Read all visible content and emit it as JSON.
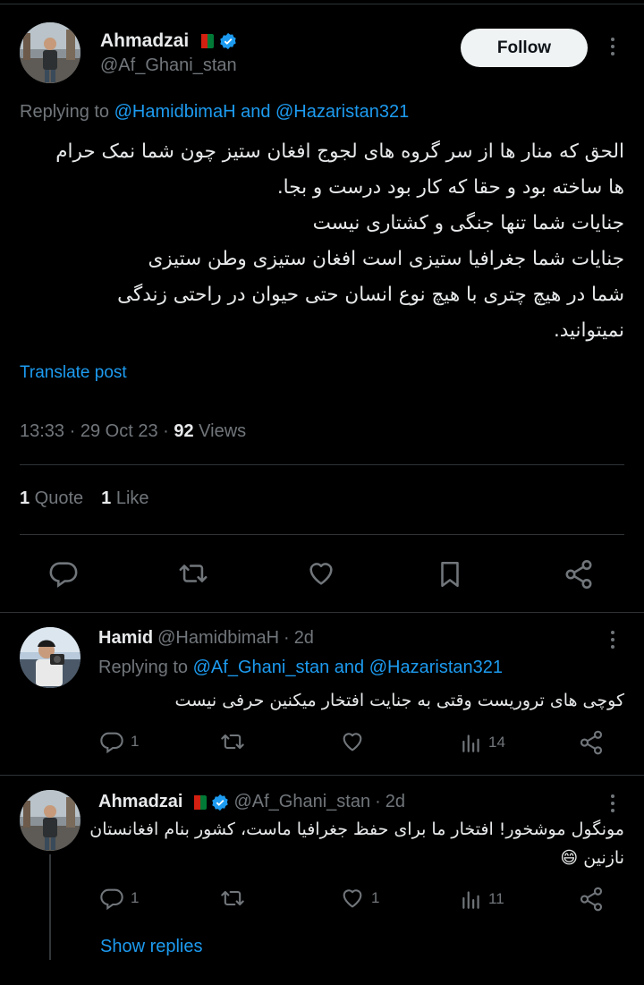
{
  "main": {
    "author_name": "Ahmadzai",
    "author_handle": "@Af_Ghani_stan",
    "follow_label": "Follow",
    "replying_prefix": "Replying to ",
    "replying_user1": "@HamidbimaH",
    "replying_and": " and ",
    "replying_user2": "@Hazaristan321",
    "text_lines": [
      "الحق که منار ها از سر گروه های لجوج افغان ستیز چون شما نمک حرام",
      "ها ساخته بود و حقا که کار بود درست و بجا.",
      "جنایات شما تنها جنگی و کشتاری نیست",
      "جنایات شما جغرافیا ستیزی است افغان ستیزی وطن ستیزی",
      "شما در هیچ چتری با هیچ نوع انسان حتی حیوان در راحتی زندگی",
      "نمیتوانید."
    ],
    "translate_label": "Translate post",
    "time": "13:33",
    "date": "29 Oct 23",
    "views_count": "92",
    "views_label": " Views",
    "quote_count": "1",
    "quote_label": " Quote",
    "like_count": "1",
    "like_label": " Like"
  },
  "replies": [
    {
      "name": "Hamid",
      "handle": "@HamidbimaH",
      "time": "2d",
      "replying_prefix": "Replying to ",
      "replying_user1": "@Af_Ghani_stan",
      "replying_and": " and ",
      "replying_user2": "@Hazaristan321",
      "text": "کوچی های تروریست وقتی به جنایت افتخار میکنین حرفی نیست",
      "reply_count": "1",
      "like_count": "",
      "views": "14"
    },
    {
      "name": "Ahmadzai",
      "handle": "@Af_Ghani_stan",
      "time": "2d",
      "text_line1": "مونگول موشخور! افتخار ما برای حفظ جغرافیا ماست، کشور بنام افغانستان",
      "text_line2": "نازنین 😄",
      "reply_count": "1",
      "like_count": "1",
      "views": "11"
    }
  ],
  "show_replies_label": "Show replies",
  "colors": {
    "accent": "#1d9bf0",
    "muted": "#71767b",
    "text": "#e7e9ea",
    "bg": "#000000"
  },
  "icons": [
    "reply-icon",
    "retweet-icon",
    "like-icon",
    "bookmark-icon",
    "share-icon",
    "views-icon",
    "verified-icon",
    "more-icon",
    "afghan-flag-icon"
  ]
}
